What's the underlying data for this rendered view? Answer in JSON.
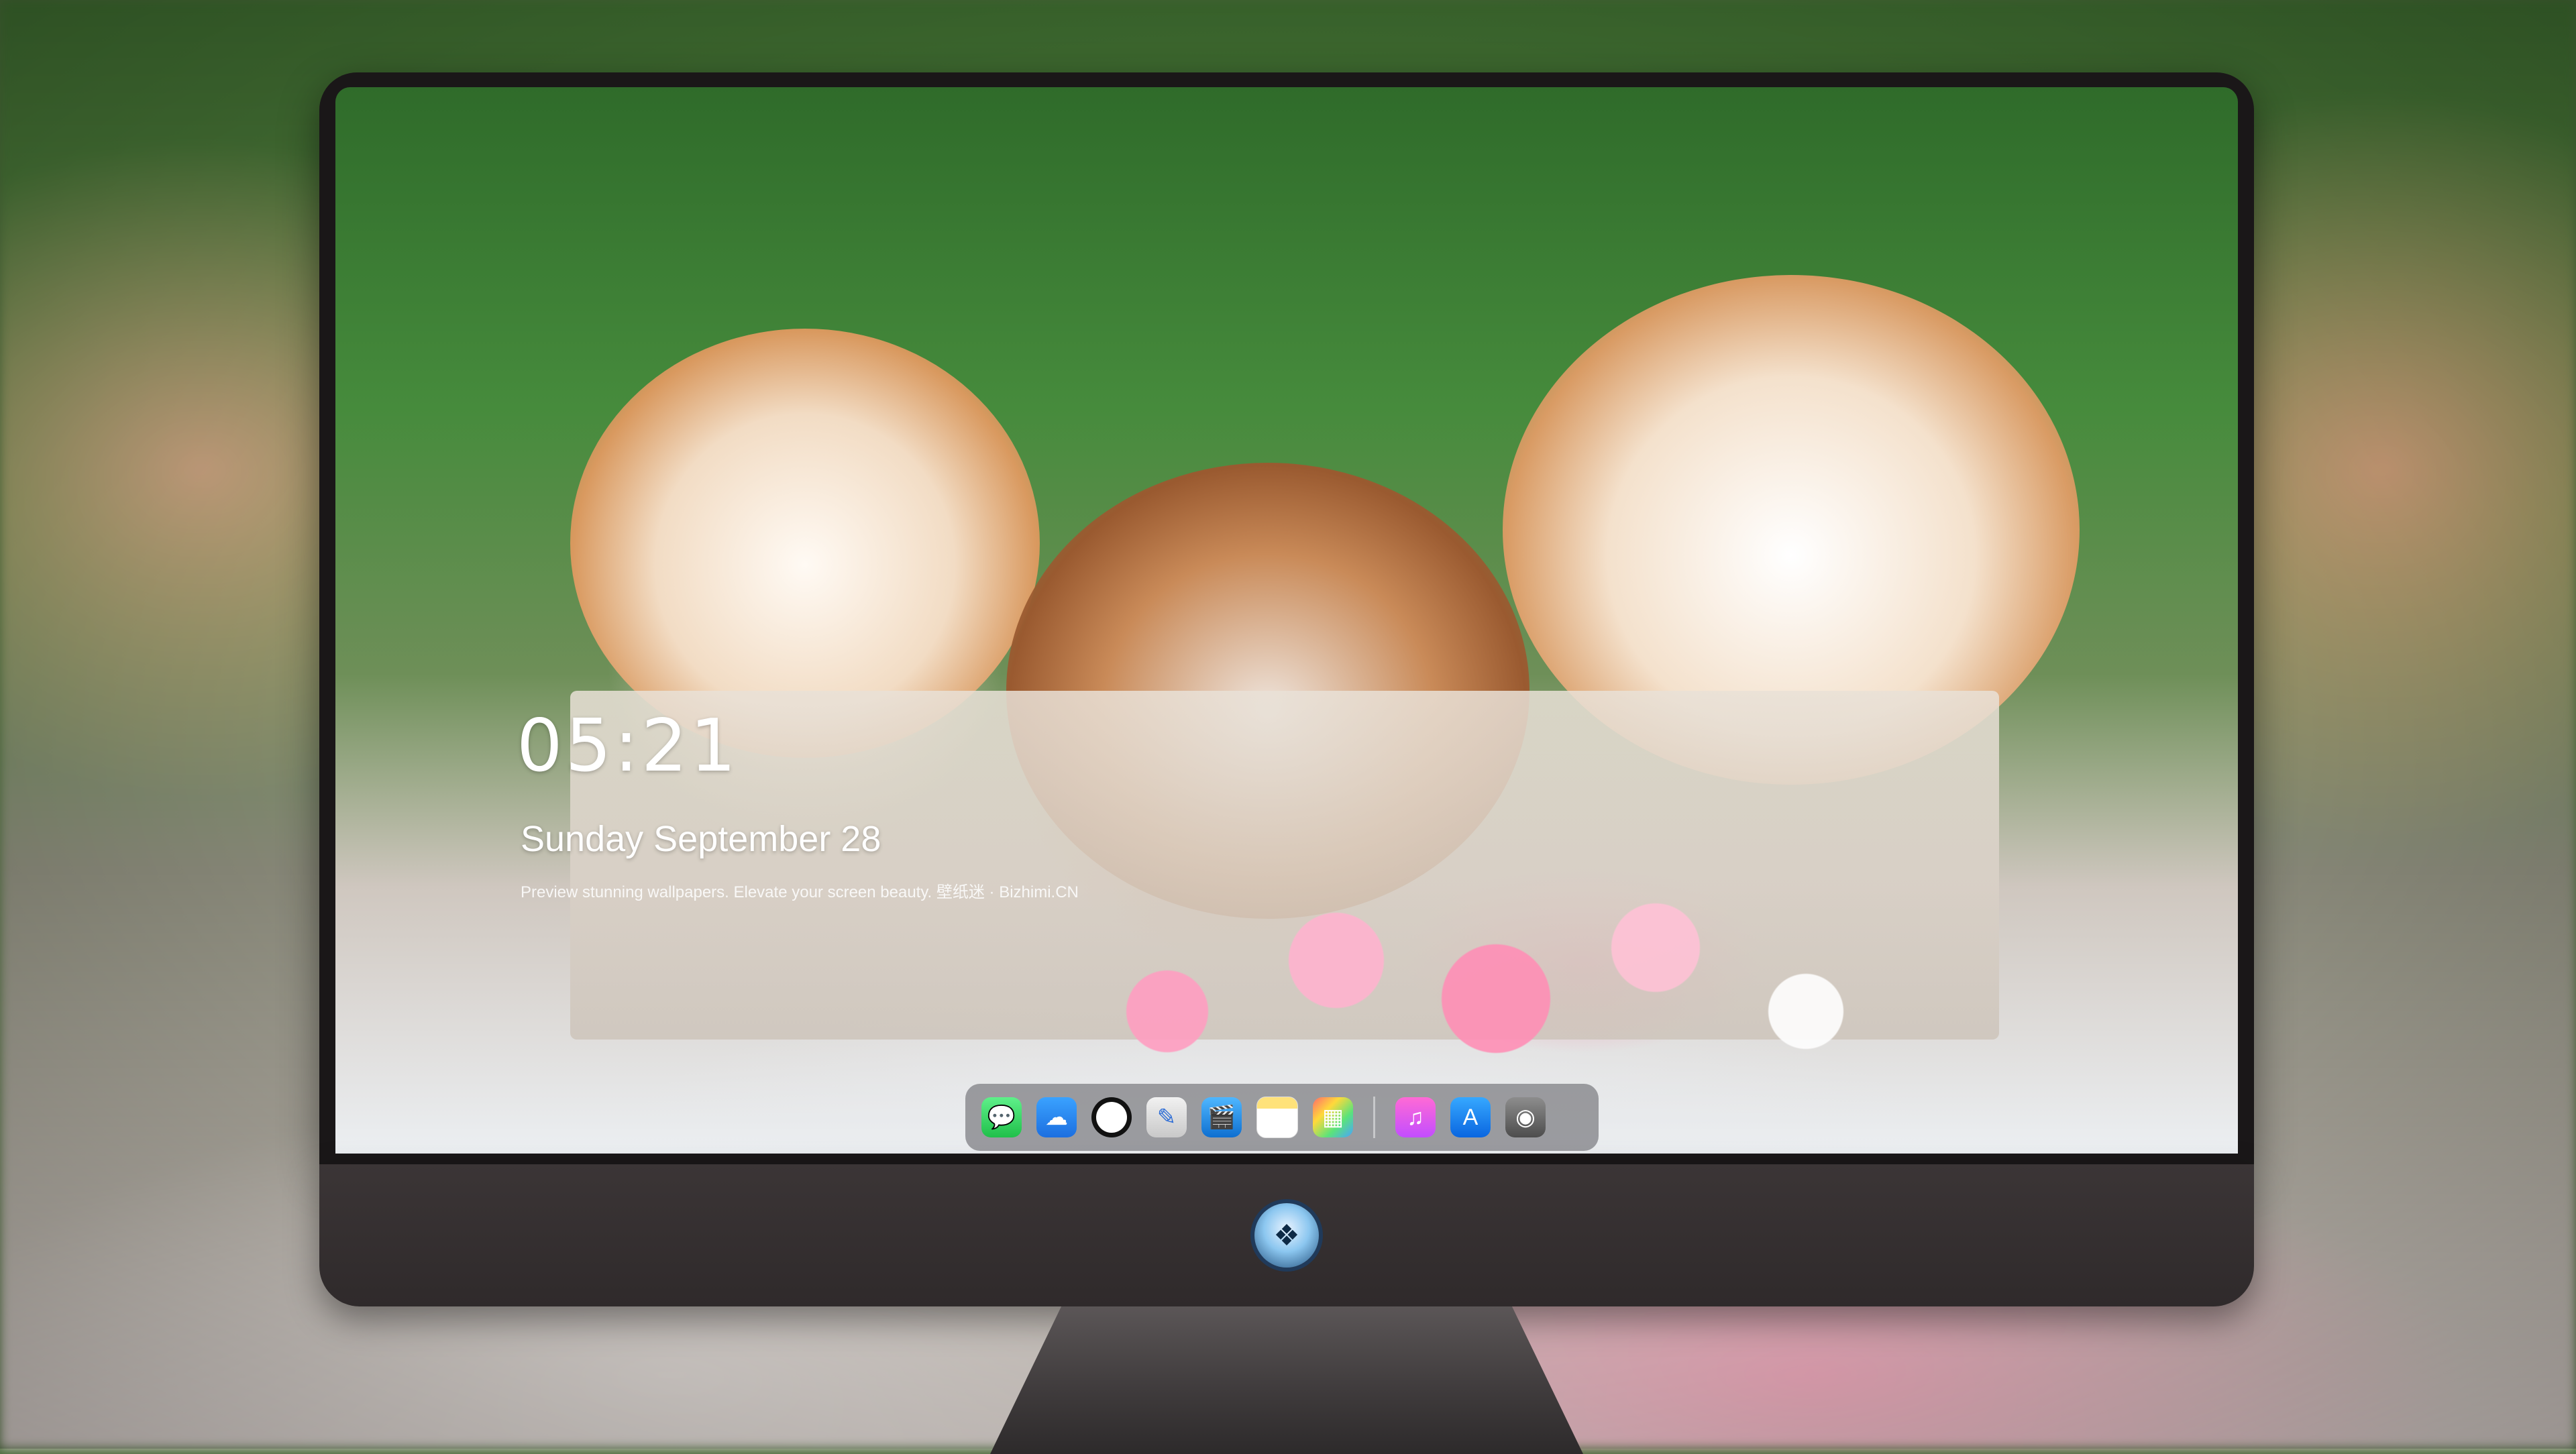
{
  "lockscreen": {
    "time": "05:21",
    "date": "Sunday September  28",
    "caption": "Preview stunning wallpapers. Elevate your screen beauty. 壁纸迷 · Bizhimi.CN"
  },
  "dock": {
    "apps": [
      {
        "name": "Messages",
        "icon": "messages-icon",
        "glyph": "💬"
      },
      {
        "name": "Weather",
        "icon": "weather-icon",
        "glyph": "☁"
      },
      {
        "name": "Clock",
        "icon": "clock-icon",
        "glyph": ""
      },
      {
        "name": "Preview",
        "icon": "preview-icon",
        "glyph": "✎"
      },
      {
        "name": "Claquette",
        "icon": "claquette-icon",
        "glyph": "🎬"
      },
      {
        "name": "Notes",
        "icon": "notes-icon",
        "glyph": ""
      },
      {
        "name": "Photos",
        "icon": "photos-icon",
        "glyph": "▦"
      },
      {
        "name": "Music",
        "icon": "music-icon",
        "glyph": "♫"
      },
      {
        "name": "App Store",
        "icon": "app-store-icon",
        "glyph": "A"
      },
      {
        "name": "Camera",
        "icon": "camera-icon",
        "glyph": "◉"
      }
    ]
  },
  "monitor": {
    "logo_icon": "bizhimi-logo-icon"
  },
  "colors": {
    "bezel": "#1a1718",
    "chin": "#3b3536",
    "text": "#ffffff"
  }
}
